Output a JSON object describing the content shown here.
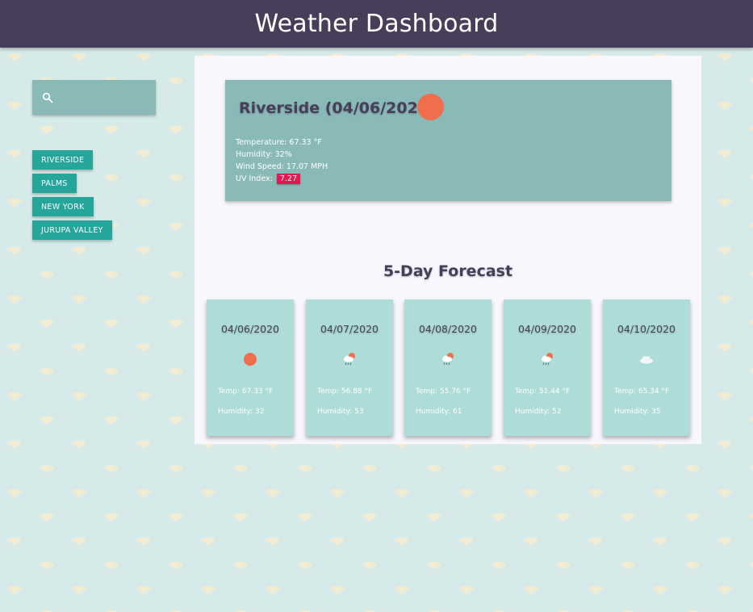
{
  "header": {
    "title": "Weather Dashboard"
  },
  "search": {
    "placeholder": "",
    "value": ""
  },
  "cities": [
    "RIVERSIDE",
    "PALMS",
    "NEW YORK",
    "JURUPA VALLEY"
  ],
  "current": {
    "title": "Riverside (04/06/2020)",
    "icon": "sun-icon",
    "temperature": "Temperature: 67.33 °F",
    "humidity": "Humidity: 32%",
    "wind": "Wind Speed: 17.07 MPH",
    "uv_label": "UV Index:",
    "uv_value": "7.27",
    "uv_color": "#e8174f"
  },
  "forecast": {
    "title": "5-Day Forecast",
    "days": [
      {
        "date": "04/06/2020",
        "icon": "sun-icon",
        "temp": "Temp: 67.33 °F",
        "humidity": "Humidity: 32"
      },
      {
        "date": "04/07/2020",
        "icon": "sun-cloud-rain-icon",
        "temp": "Temp: 56.88 °F",
        "humidity": "Humidity: 53"
      },
      {
        "date": "04/08/2020",
        "icon": "sun-cloud-rain-icon",
        "temp": "Temp: 55.76 °F",
        "humidity": "Humidity: 61"
      },
      {
        "date": "04/09/2020",
        "icon": "sun-cloud-rain-icon",
        "temp": "Temp: 51.44 °F",
        "humidity": "Humidity: 52"
      },
      {
        "date": "04/10/2020",
        "icon": "cloud-icon",
        "temp": "Temp: 65.34 °F",
        "humidity": "Humidity: 35"
      }
    ]
  },
  "colors": {
    "header_bg": "#473e59",
    "city_button": "#26a69a",
    "card_bg": "#8abab8",
    "forecast_card_bg": "#aedcd8",
    "sun": "#ef6f4c"
  }
}
